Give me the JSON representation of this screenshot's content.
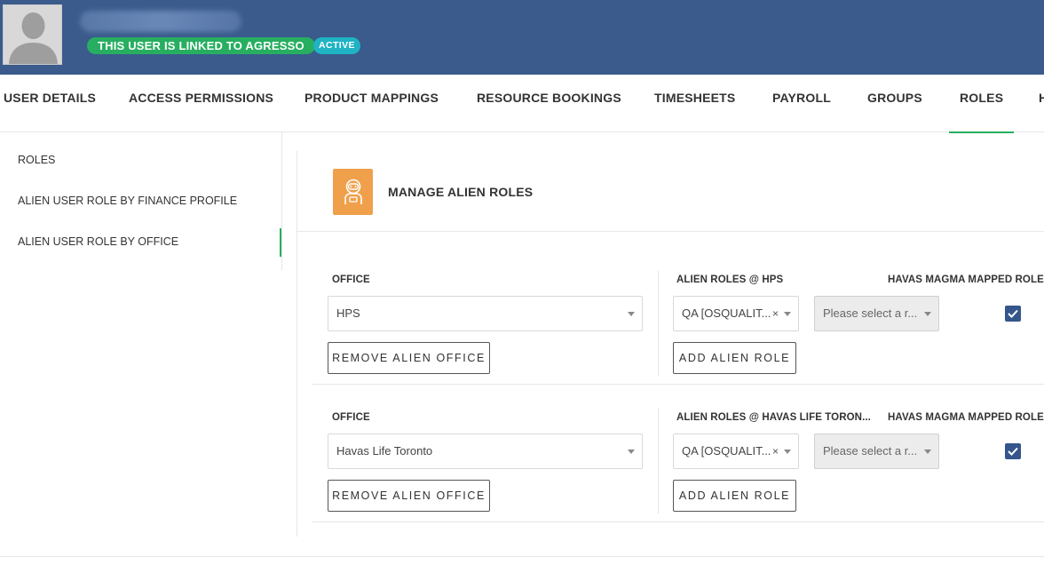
{
  "header": {
    "linked_badge": "THIS USER IS LINKED TO AGRESSO",
    "status_badge": "ACTIVE"
  },
  "tabs": [
    {
      "label": "USER DETAILS"
    },
    {
      "label": "ACCESS PERMISSIONS"
    },
    {
      "label": "PRODUCT MAPPINGS"
    },
    {
      "label": "RESOURCE BOOKINGS"
    },
    {
      "label": "TIMESHEETS"
    },
    {
      "label": "PAYROLL"
    },
    {
      "label": "GROUPS"
    },
    {
      "label": "ROLES"
    },
    {
      "label": "H"
    }
  ],
  "active_tab": "ROLES",
  "sidebar": {
    "items": [
      {
        "label": "ROLES"
      },
      {
        "label": "ALIEN USER ROLE BY FINANCE PROFILE"
      },
      {
        "label": "ALIEN USER ROLE BY OFFICE"
      }
    ],
    "active_item": "ALIEN USER ROLE BY OFFICE"
  },
  "panel": {
    "title": "MANAGE ALIEN ROLES",
    "icon": "astronaut-icon",
    "accent_color": "#f0a04b"
  },
  "rows": [
    {
      "office_label": "OFFICE",
      "office_value": "HPS",
      "roles_label": "ALIEN ROLES @ HPS",
      "role_chip": "QA [OSQUALIT...",
      "role_placeholder": "Please select a r...",
      "mapped_label": "HAVAS MAGMA MAPPED ROLE",
      "remove_button": "REMOVE ALIEN OFFICE",
      "add_button": "ADD ALIEN ROLE",
      "mapped_checked": true
    },
    {
      "office_label": "OFFICE",
      "office_value": "Havas Life Toronto",
      "roles_label": "ALIEN ROLES @ HAVAS LIFE TORON...",
      "role_chip": "QA [OSQUALIT...",
      "role_placeholder": "Please select a r...",
      "mapped_label": "HAVAS MAGMA MAPPED ROLE",
      "remove_button": "REMOVE ALIEN OFFICE",
      "add_button": "ADD ALIEN ROLE",
      "mapped_checked": true
    }
  ],
  "colors": {
    "header_bg": "#3a5b8c",
    "linked_badge_bg": "#27ae60",
    "active_badge_bg": "#1fb3c4",
    "checkbox_bg": "#34568b"
  }
}
